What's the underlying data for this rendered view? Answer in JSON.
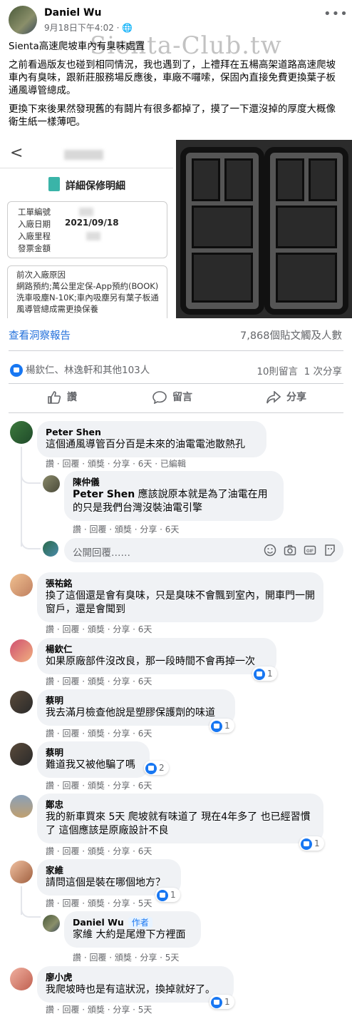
{
  "post": {
    "author": "Daniel Wu",
    "meta": "9月18日下午4:02 · 🌐",
    "watermark": "Sienta-Club.tw",
    "title": "Sienta高速爬坡車內有臭味處置",
    "para1": "之前看過版友也碰到相同情況，我也遇到了，上禮拜在五楊高架道路高速爬坡車內有臭味，跟新莊服務場反應後，車廠不囉嗦，保固內直接免費更換葉子板通風導管總成。",
    "para2": "更換下來後果然發現舊的有鬪片有很多都掉了，摸了一下還沒掉的厚度大概像衛生紙一樣薄吧。"
  },
  "receipt": {
    "back": "<",
    "title": "詳細保修明細",
    "rows": [
      {
        "label": "工單編號",
        "value": ""
      },
      {
        "label": "入廠日期",
        "value": "2021/09/18"
      },
      {
        "label": "入廠里程",
        "value": ""
      },
      {
        "label": "發票金額",
        "value": ""
      }
    ],
    "reason_title": "前次入廠原因",
    "reason_text": "網路預約;萬公里定保-App預約(BOOK)洗車吸塵N-10K;車內吸塵另有葉子板通風導管總成需更換保養"
  },
  "stats": {
    "insights": "查看洞察報告",
    "reach": "7,868個貼文觸及人數",
    "reactions": "楊欽仁、林逸軒和其他103人",
    "comments_count": "10則留言",
    "shares_count": "1 次分享"
  },
  "actions": {
    "like": "讚",
    "comment": "留言",
    "share": "分享"
  },
  "reply_placeholder": "公開回覆……",
  "comments": [
    {
      "name": "Peter Shen",
      "text": "這個通風導管百分百是未來的油電電池散熱孔",
      "actions": "讚 · 回覆 · 頒獎 · 分享 · 6天 · 已編輯"
    },
    {
      "name": "陳仲儀",
      "mention": "Peter Shen",
      "text": " 應該說原本就是為了油電在用的只是我們台灣沒裝油電引擎",
      "actions": "讚 · 回覆 · 頒獎 · 分享 · 6天"
    },
    {
      "name": "張祐銘",
      "text": "換了這個還是會有臭味，只是臭味不會飄到室內，開車門一開窗戶，還是會聞到",
      "actions": "讚 · 回覆 · 頒獎 · 分享 · 6天"
    },
    {
      "name": "楊欽仁",
      "text": "如果原廠部件沒改良，那一段時間不會再掉一次",
      "actions": "讚 · 回覆 · 頒獎 · 分享 · 6天",
      "likes": "1"
    },
    {
      "name": "蔡明",
      "text": "我去滿月檢查他說是塑膠保護劑的味道",
      "actions": "讚 · 回覆 · 頒獎 · 分享 · 6天",
      "likes": "1"
    },
    {
      "name": "蔡明",
      "text": "難道我又被他騙了嗎",
      "actions": "讚 · 回覆 · 頒獎 · 分享 · 6天",
      "likes": "2"
    },
    {
      "name": "鄭忠",
      "text": "我的新車買來 5天 爬坡就有味道了 現在4年多了 也已經習慣了 這個應該是原廠設計不良",
      "actions": "讚 · 回覆 · 頒獎 · 分享 · 6天",
      "likes": "1"
    },
    {
      "name": "家維",
      "text": "請問這個是裝在哪個地方？",
      "actions": "讚 · 回覆 · 頒獎 · 分享 · 5天",
      "likes": "1"
    },
    {
      "name": "Daniel Wu",
      "badge": "作者",
      "text": "家維 大約是尾燈下方裡面",
      "actions": "讚 · 回覆 · 頒獎 · 分享 · 5天"
    },
    {
      "name": "廖小虎",
      "text": "我爬坡時也是有這狀況，換掉就好了。",
      "actions": "讚 · 回覆 · 頒獎 · 分享 · 5天",
      "likes": "1"
    }
  ],
  "colors": {
    "accent": "#216fdb",
    "like": "#1877f2",
    "bubble": "#f0f2f5",
    "muted": "#65676b"
  }
}
